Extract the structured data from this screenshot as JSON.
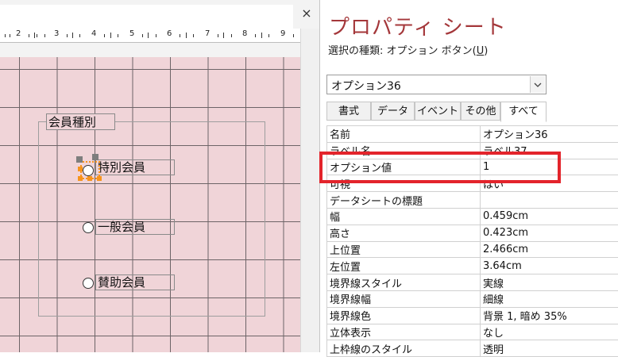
{
  "left_pane": {
    "close_glyph": "×",
    "ruler_numbers": [
      "2",
      "3",
      "4",
      "5",
      "6",
      "7",
      "8",
      "9"
    ],
    "frame_label": "会員種別",
    "options": [
      {
        "label": "特別会員",
        "selected": true
      },
      {
        "label": "一般会員",
        "selected": false
      },
      {
        "label": "賛助会員",
        "selected": false
      }
    ]
  },
  "property_sheet": {
    "title": "プロパティ シート",
    "selection_type_prefix": "選択の種類: オプション ボタン(",
    "selection_type_key": "U",
    "selection_type_suffix": ")",
    "object_combo_value": "オプション36",
    "tabs": [
      "書式",
      "データ",
      "イベント",
      "その他",
      "すべて"
    ],
    "active_tab": "すべて",
    "rows": [
      {
        "name": "名前",
        "value": "オプション36"
      },
      {
        "name": "ラベル名",
        "value": "ラベル37"
      },
      {
        "name": "オプション値",
        "value": "1"
      },
      {
        "name": "可視",
        "value": "はい"
      },
      {
        "name": "データシートの標題",
        "value": ""
      },
      {
        "name": "幅",
        "value": "0.459cm"
      },
      {
        "name": "高さ",
        "value": "0.423cm"
      },
      {
        "name": "上位置",
        "value": "2.466cm"
      },
      {
        "name": "左位置",
        "value": "3.64cm"
      },
      {
        "name": "境界線スタイル",
        "value": "実線"
      },
      {
        "name": "境界線幅",
        "value": "細線"
      },
      {
        "name": "境界線色",
        "value": "背景 1, 暗め 35%"
      },
      {
        "name": "立体表示",
        "value": "なし"
      },
      {
        "name": "上枠線のスタイル",
        "value": "透明"
      }
    ]
  },
  "colors": {
    "title_red": "#a4373a",
    "highlight_red": "#e3242b",
    "grid_pink": "#f0d4d8",
    "selection_orange": "#f7941d"
  }
}
